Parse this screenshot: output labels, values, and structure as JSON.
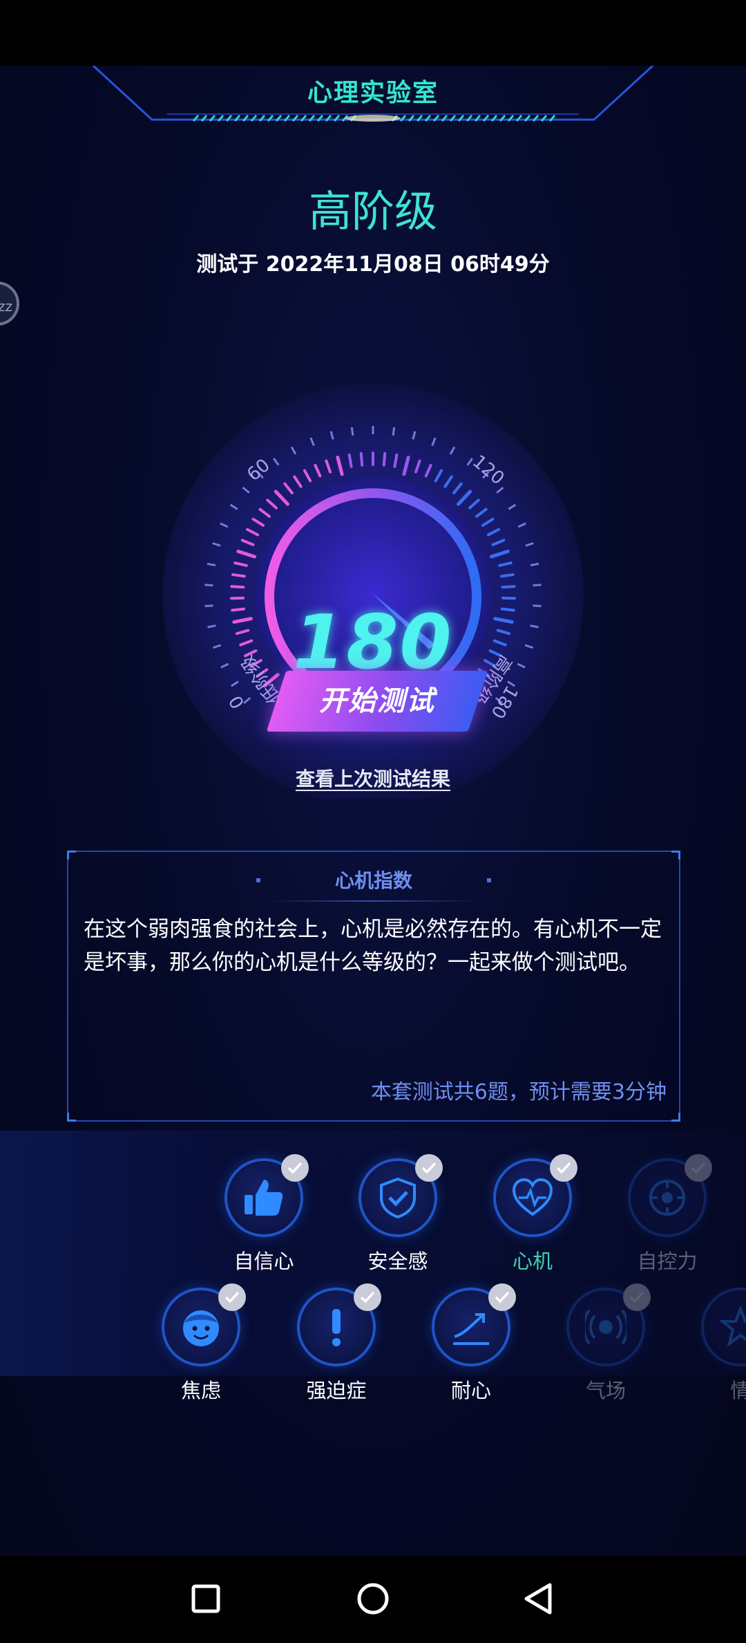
{
  "header": {
    "title": "心理实验室"
  },
  "result": {
    "level": "高阶级",
    "test_time": "测试于 2022年11月08日 06时49分",
    "side_bubble": "zz"
  },
  "gauge": {
    "value": "180",
    "min": 0,
    "max": 180,
    "current": 180,
    "ticks": [
      "60",
      "120"
    ],
    "min_label": "0",
    "max_label": "180",
    "low_level": "低阶级",
    "high_level": "高阶级"
  },
  "actions": {
    "start": "开始测试",
    "last_result": "查看上次测试结果"
  },
  "info": {
    "title": "心机指数",
    "description": "在这个弱肉强食的社会上，心机是必然存在的。有心机不一定是坏事，那么你的心机是什么等级的？一起来做个测试吧。",
    "meta": "本套测试共6题，预计需要3分钟"
  },
  "categories": {
    "row1": [
      {
        "label": "自信心",
        "icon": "thumbs-up-icon"
      },
      {
        "label": "安全感",
        "icon": "shield-check-icon"
      },
      {
        "label": "心机",
        "icon": "heart-pulse-icon"
      },
      {
        "label": "自控力",
        "icon": "target-icon"
      }
    ],
    "row2": [
      {
        "label": "焦虑",
        "icon": "face-icon"
      },
      {
        "label": "强迫症",
        "icon": "exclamation-icon"
      },
      {
        "label": "耐心",
        "icon": "trend-arrow-icon"
      },
      {
        "label": "气场",
        "icon": "broadcast-icon"
      },
      {
        "label": "情",
        "icon": "star-icon"
      }
    ]
  },
  "colors": {
    "accent": "#3fe1d6",
    "gauge_value": "#4ef2ee",
    "link_blue": "#6f8ff0"
  }
}
